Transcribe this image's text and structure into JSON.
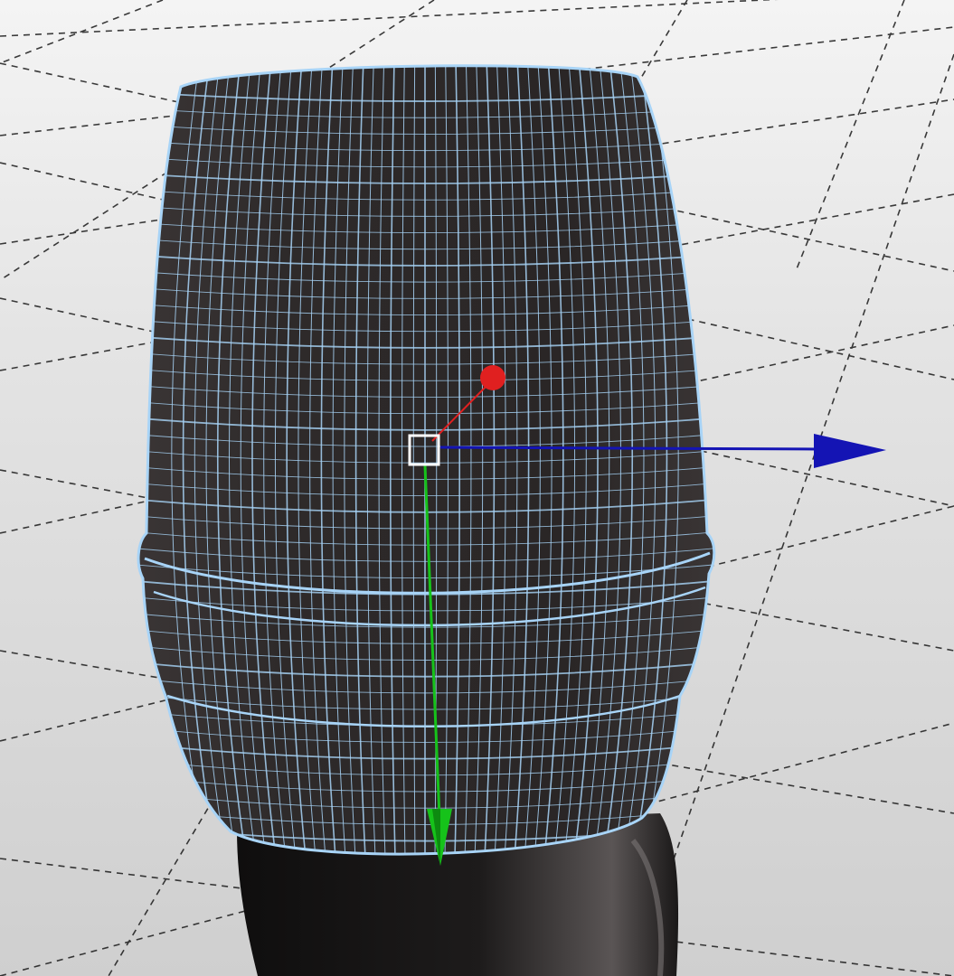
{
  "viewport": {
    "background_color": "#d9d9d9",
    "grid_line_color": "#1a1a1a",
    "grid_visible": true
  },
  "model": {
    "mesh_fill_color": "#2c2828",
    "wireframe_color": "#a8d4f7",
    "handle_fill_color": "#141212",
    "selected": true
  },
  "gizmo": {
    "type": "translate",
    "x_axis_color": "#1414b4",
    "y_axis_color": "#16c21a",
    "z_axis_color": "#e02020",
    "pivot_icon": "square-pivot-icon"
  }
}
